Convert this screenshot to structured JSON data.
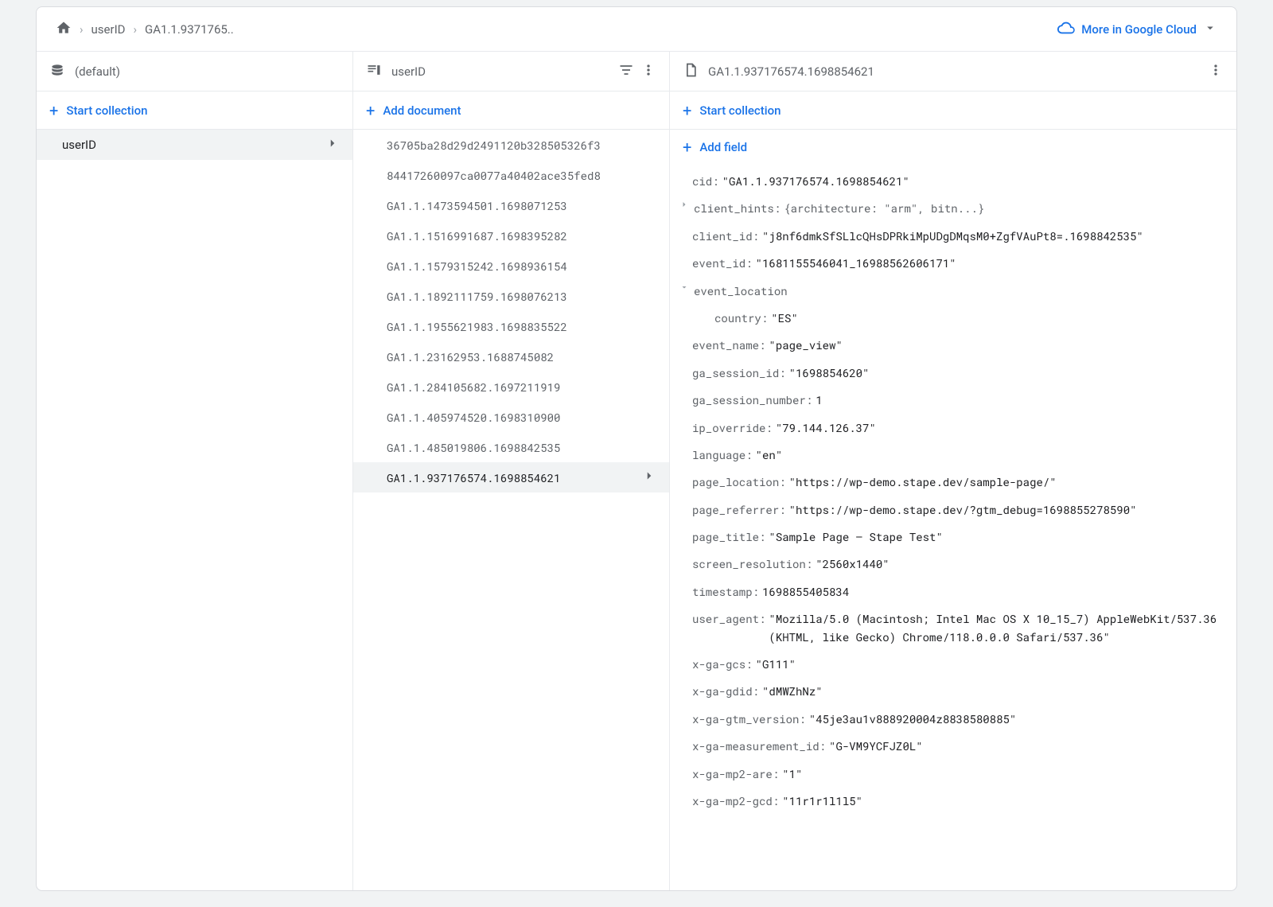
{
  "breadcrumb": {
    "items": [
      "userID",
      "GA1.1.9371765.."
    ]
  },
  "cloud_link": "More in Google Cloud",
  "col1": {
    "title": "(default)",
    "action": "Start collection",
    "items": [
      {
        "label": "userID",
        "selected": true
      }
    ]
  },
  "col2": {
    "title": "userID",
    "action": "Add document",
    "items": [
      "36705ba28d29d2491120b328505326f3",
      "84417260097ca0077a40402ace35fed8",
      "GA1.1.1473594501.1698071253",
      "GA1.1.1516991687.1698395282",
      "GA1.1.1579315242.1698936154",
      "GA1.1.1892111759.1698076213",
      "GA1.1.1955621983.1698835522",
      "GA1.1.23162953.1688745082",
      "GA1.1.284105682.1697211919",
      "GA1.1.405974520.1698310900",
      "GA1.1.485019806.1698842535",
      "GA1.1.937176574.1698854621"
    ],
    "selected_index": 11
  },
  "col3": {
    "title": "GA1.1.937176574.1698854621",
    "action1": "Start collection",
    "action2": "Add field",
    "fields": [
      {
        "key": "cid",
        "val": "GA1.1.937176574.1698854621",
        "type": "str"
      },
      {
        "key": "client_hints",
        "preview": "{architecture: \"arm\", bitn...}",
        "expandable": true,
        "expanded": false
      },
      {
        "key": "client_id",
        "val": "j8nf6dmkSfSLlcQHsDPRkiMpUDgDMqsM0+ZgfVAuPt8=.1698842535",
        "type": "str"
      },
      {
        "key": "event_id",
        "val": "1681155546041_16988562606171",
        "type": "str"
      },
      {
        "key": "event_location",
        "expandable": true,
        "expanded": true,
        "children": [
          {
            "key": "country",
            "val": "ES",
            "type": "str"
          }
        ]
      },
      {
        "key": "event_name",
        "val": "page_view",
        "type": "str"
      },
      {
        "key": "ga_session_id",
        "val": "1698854620",
        "type": "str"
      },
      {
        "key": "ga_session_number",
        "val": "1",
        "type": "num"
      },
      {
        "key": "ip_override",
        "val": "79.144.126.37",
        "type": "str"
      },
      {
        "key": "language",
        "val": "en",
        "type": "str"
      },
      {
        "key": "page_location",
        "val": "https://wp-demo.stape.dev/sample-page/",
        "type": "str"
      },
      {
        "key": "page_referrer",
        "val": "https://wp-demo.stape.dev/?gtm_debug=1698855278590",
        "type": "str"
      },
      {
        "key": "page_title",
        "val": "Sample Page – Stape Test",
        "type": "str"
      },
      {
        "key": "screen_resolution",
        "val": "2560x1440",
        "type": "str"
      },
      {
        "key": "timestamp",
        "val": "1698855405834",
        "type": "num"
      },
      {
        "key": "user_agent",
        "val": "Mozilla/5.0 (Macintosh; Intel Mac OS X 10_15_7) AppleWebKit/537.36 (KHTML, like Gecko) Chrome/118.0.0.0 Safari/537.36",
        "type": "str",
        "multi": true
      },
      {
        "key": "x-ga-gcs",
        "val": "G111",
        "type": "str"
      },
      {
        "key": "x-ga-gdid",
        "val": "dMWZhNz",
        "type": "str"
      },
      {
        "key": "x-ga-gtm_version",
        "val": "45je3au1v888920004z8838580885",
        "type": "str"
      },
      {
        "key": "x-ga-measurement_id",
        "val": "G-VM9YCFJZ0L",
        "type": "str"
      },
      {
        "key": "x-ga-mp2-are",
        "val": "1",
        "type": "str"
      },
      {
        "key": "x-ga-mp2-gcd",
        "val": "11r1r1l1l5",
        "type": "str"
      }
    ]
  }
}
